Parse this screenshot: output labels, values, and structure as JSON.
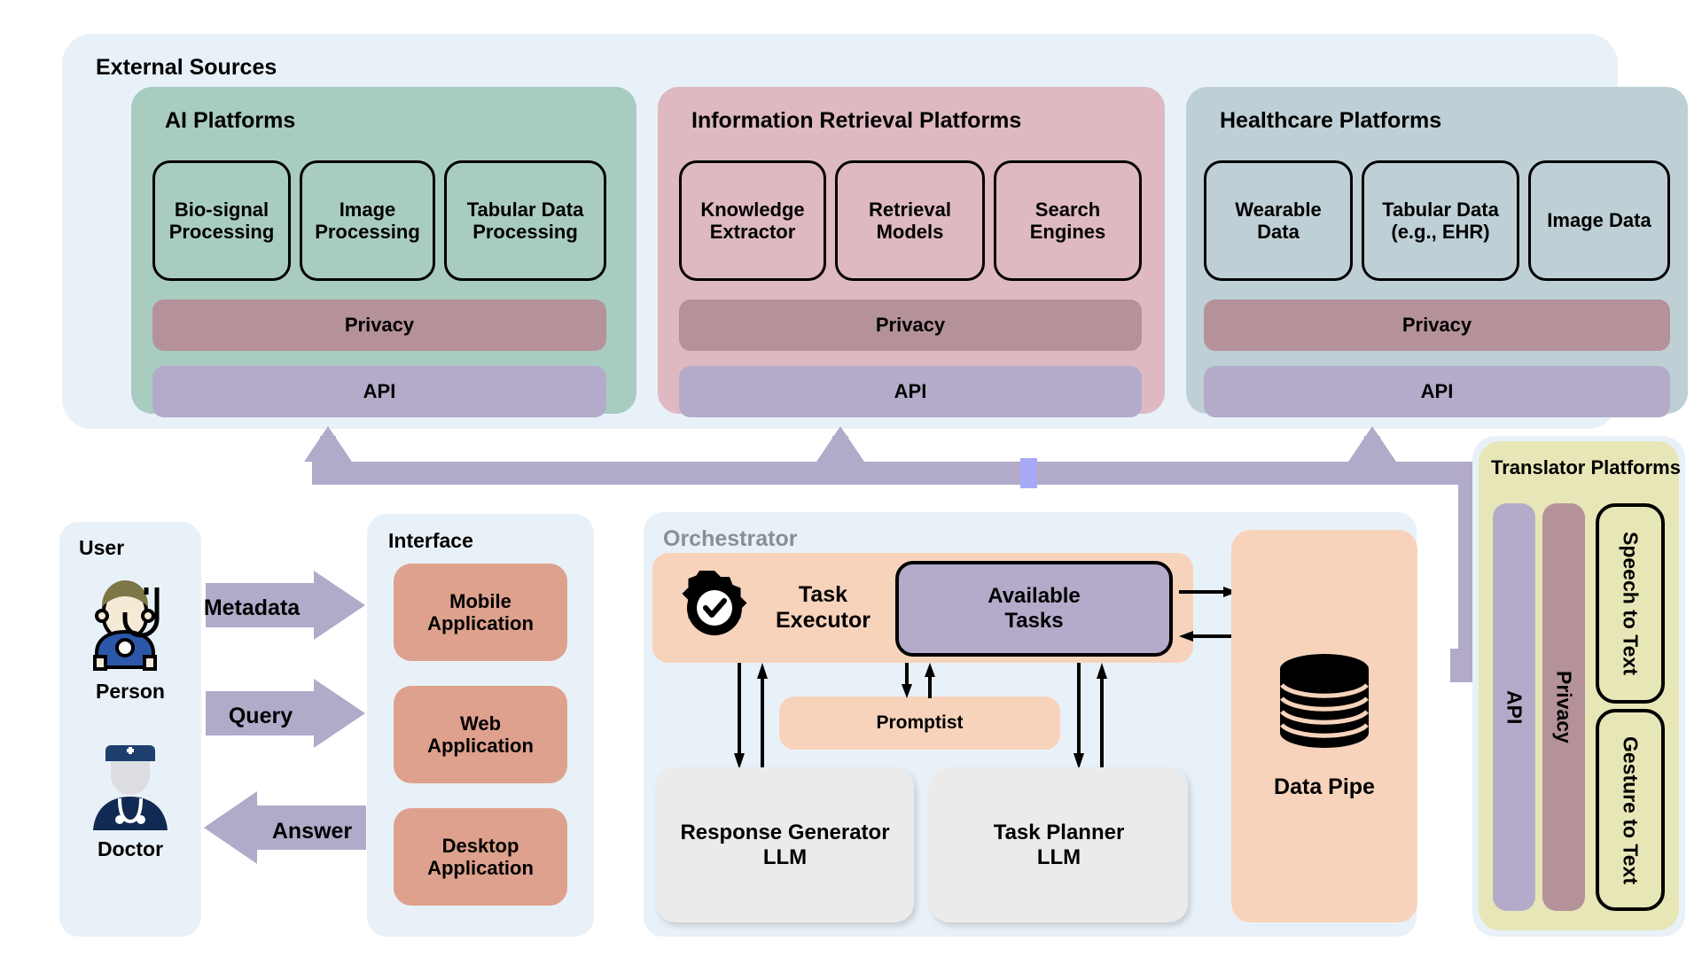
{
  "external": {
    "title": "External Sources",
    "platforms": [
      {
        "title": "AI Platforms",
        "units": [
          "Bio-signal\nProcessing",
          "Image\nProcessing",
          "Tabular Data\nProcessing"
        ],
        "privacy": "Privacy",
        "api": "API",
        "color": "#a9ccc0"
      },
      {
        "title": "Information Retrieval Platforms",
        "units": [
          "Knowledge\nExtractor",
          "Retrieval\nModels",
          "Search\nEngines"
        ],
        "privacy": "Privacy",
        "api": "API",
        "color": "#deb9c1"
      },
      {
        "title": "Healthcare Platforms",
        "units": [
          "Wearable\nData",
          "Tabular Data\n(e.g., EHR)",
          "Image Data"
        ],
        "privacy": "Privacy",
        "api": "API",
        "color": "#bed0d5"
      }
    ]
  },
  "translator": {
    "title": "Translator Platforms",
    "api": "API",
    "privacy": "Privacy",
    "boxes": [
      "Speech to Text",
      "Gesture to Text"
    ],
    "panel_color": "#e7e6b7"
  },
  "user": {
    "title": "User",
    "person_label": "Person",
    "doctor_label": "Doctor"
  },
  "arrows": {
    "metadata": "Metadata",
    "query": "Query",
    "answer": "Answer",
    "color": "#b2aac9"
  },
  "interface": {
    "title": "Interface",
    "apps": [
      "Mobile\nApplication",
      "Web\nApplication",
      "Desktop\nApplication"
    ]
  },
  "orchestrator": {
    "title": "Orchestrator",
    "task_executor": "Task\nExecutor",
    "available_tasks": "Available\nTasks",
    "promptist": "Promptist",
    "response_generator": "Response Generator\nLLM",
    "task_planner": "Task Planner\nLLM",
    "data_pipe": "Data Pipe"
  },
  "icons": {
    "gear_check": "gear-check-icon",
    "database": "database-stack-icon",
    "person": "person-with-stethoscope-icon",
    "doctor": "doctor-icon"
  }
}
